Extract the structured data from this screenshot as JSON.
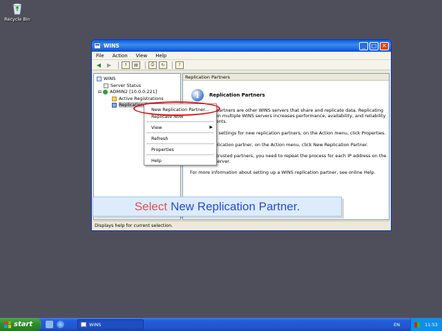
{
  "desktop": {
    "recycle_bin_label": "Recycle Bin"
  },
  "window": {
    "title": "WINS",
    "menu": [
      "File",
      "Action",
      "View",
      "Help"
    ],
    "tree": {
      "root": "WINS",
      "server_status": "Server Status",
      "server": "ADMIN2 [10.0.0.221]",
      "active_registrations": "Active Registrations",
      "replication_partners": "Replication Partners"
    },
    "detail": {
      "header": "Replication Partners",
      "title": "Replication Partners",
      "lines": [
        "Replication partners are other WINS servers that share and replicate data. Replicating",
        "data between multiple WINS servers increases performance, availability, and reliability",
        "for WINS clients.",
        "To configure settings for new replication partners, on the Action menu, click Properties.",
        "To add a replication partner, on the Action menu, click New Replication Partner.",
        "If you have trusted partners, you need to repeat the process for each IP address on the",
        "replication server.",
        "For more information about setting up a WINS replication partner, see online Help."
      ]
    },
    "status": "Displays help for current selection."
  },
  "context_menu": {
    "items": [
      "New Replication Partner...",
      "Replicate Now",
      "View",
      "Refresh",
      "Properties",
      "Help"
    ]
  },
  "caption": {
    "word1": "Select",
    "word2": "New Replication Partner."
  },
  "taskbar": {
    "start": "start",
    "task_label": "WINS",
    "language": "EN",
    "clock": "11:53"
  },
  "colors": {
    "desktop": "#4e4f5b",
    "highlight_ring": "#e01010",
    "caption_red": "#e05050",
    "caption_blue": "#2a4ad8"
  }
}
